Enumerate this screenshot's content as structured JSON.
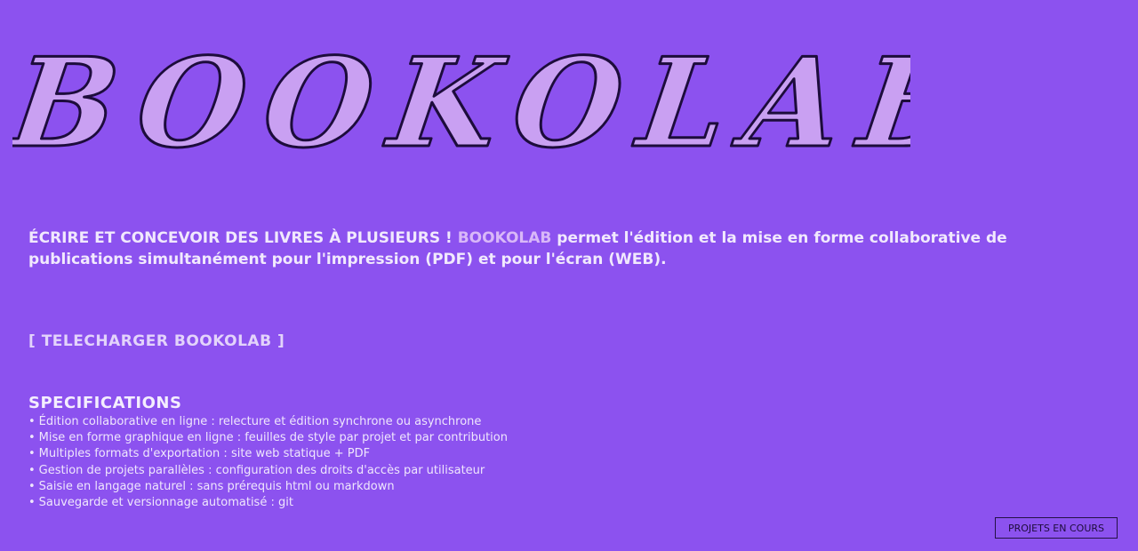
{
  "logo": {
    "text": "BOOKOLAB",
    "fill_color": "#c9a0f2",
    "outline_color": "#1d0c3c"
  },
  "intro": {
    "lead": "ÉCRIRE ET CONCEVOIR DES LIVRES À PLUSIEURS !",
    "brand": "BOOKOLAB",
    "body": "permet l'édition et la mise en forme collaborative de publications simultanément pour l'impression (PDF) et pour l'écran (WEB)."
  },
  "download_link": "[ TELECHARGER BOOKOLAB ]",
  "specs": {
    "title": "SPECIFICATIONS",
    "items": [
      "Édition collaborative en ligne : relecture et édition synchrone ou asynchrone",
      "Mise en forme graphique en ligne : feuilles de style par projet et par contribution",
      "Multiples formats d'exportation : site web statique + PDF",
      "Gestion de projets parallèles : configuration des droits d'accès par utilisateur",
      "Saisie en langage naturel : sans prérequis html ou markdown",
      "Sauvegarde et versionnage automatisé : git"
    ]
  },
  "projets_button": "PROJETS EN COURS",
  "colors": {
    "background": "#8c52ef",
    "text": "#f1e9fd",
    "brand_highlight": "#d9b8f8",
    "dark": "#1d0c3c"
  }
}
